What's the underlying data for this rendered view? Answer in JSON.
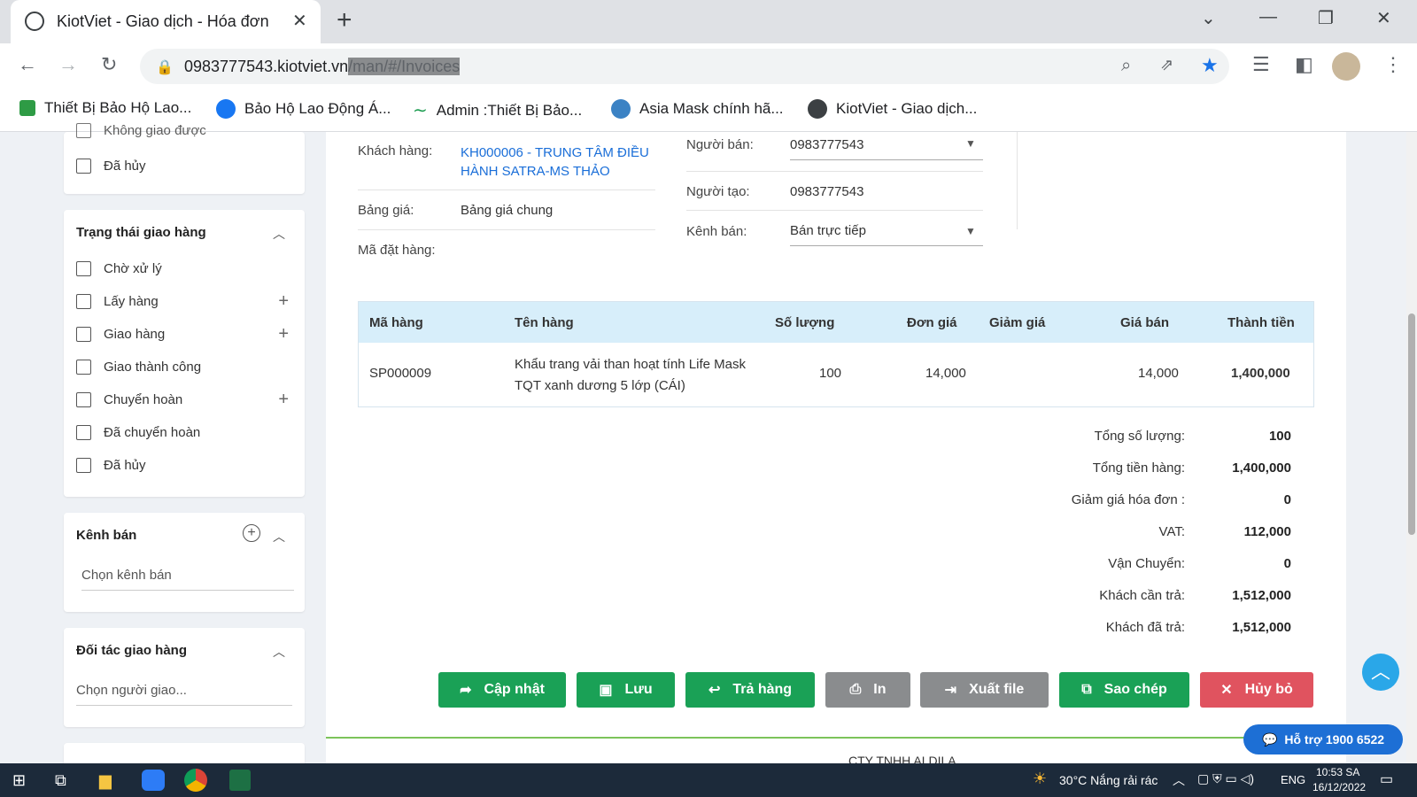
{
  "browser": {
    "tab_title": "KiotViet - Giao dịch - Hóa đơn",
    "url_host": "0983777543.kiotviet.vn",
    "url_path": "/man/#/Invoices",
    "bookmarks": [
      {
        "label": "Thiết Bị Bảo Hộ Lao...",
        "icon": "asia-safe-logo-icon",
        "color": "#2e9b45"
      },
      {
        "label": "Bảo Hộ Lao Động Á...",
        "icon": "facebook-icon",
        "color": "#1877f2"
      },
      {
        "label": "Admin :Thiết Bị Bảo...",
        "icon": "wave-icon",
        "color": "#1a9c4f"
      },
      {
        "label": "Asia Mask chính hã...",
        "icon": "globe-grid-icon",
        "color": "#3b82c4"
      },
      {
        "label": "KiotViet - Giao dịch...",
        "icon": "globe-icon",
        "color": "#3c4043"
      }
    ]
  },
  "sidebar": {
    "top_partial_label": "Không giao được",
    "top_cancelled": "Đã hủy",
    "delivery_status": {
      "title": "Trạng thái giao hàng",
      "items": [
        {
          "label": "Chờ xử lý",
          "expandable": false
        },
        {
          "label": "Lấy hàng",
          "expandable": true
        },
        {
          "label": "Giao hàng",
          "expandable": true
        },
        {
          "label": "Giao thành công",
          "expandable": false
        },
        {
          "label": "Chuyển hoàn",
          "expandable": true
        },
        {
          "label": "Đã chuyển hoàn",
          "expandable": false
        },
        {
          "label": "Đã hủy",
          "expandable": false
        }
      ]
    },
    "channel": {
      "title": "Kênh bán",
      "placeholder": "Chọn kênh bán"
    },
    "partner": {
      "title": "Đối tác giao hàng",
      "placeholder": "Chọn người giao..."
    }
  },
  "invoice": {
    "customer_label": "Khách hàng:",
    "customer_value": "KH000006 - TRUNG TÂM ĐIỀU HÀNH SATRA-MS THẢO",
    "pricebook_label": "Bảng giá:",
    "pricebook_value": "Bảng giá chung",
    "order_code_label": "Mã đặt hàng:",
    "seller_label": "Người bán:",
    "seller_value": "0983777543",
    "creator_label": "Người tạo:",
    "creator_value": "0983777543",
    "channel_label": "Kênh bán:",
    "channel_value": "Bán trực tiếp"
  },
  "table": {
    "headers": [
      "Mã hàng",
      "Tên hàng",
      "Số lượng",
      "Đơn giá",
      "Giảm giá",
      "Giá bán",
      "Thành tiền"
    ],
    "rows": [
      {
        "code": "SP000009",
        "name": "Khẩu trang vải than hoạt tính Life Mask TQT xanh dương 5 lớp (CÁI)",
        "qty": "100",
        "unit_price": "14,000",
        "discount": "",
        "sale_price": "14,000",
        "total": "1,400,000"
      }
    ]
  },
  "summary": [
    {
      "label": "Tổng số lượng:",
      "value": "100"
    },
    {
      "label": "Tổng tiền hàng:",
      "value": "1,400,000"
    },
    {
      "label": "Giảm giá hóa đơn :",
      "value": "0"
    },
    {
      "label": "VAT:",
      "value": "112,000"
    },
    {
      "label": "Vận Chuyển:",
      "value": "0"
    },
    {
      "label": "Khách cần trả:",
      "value": "1,512,000"
    },
    {
      "label": "Khách đã trả:",
      "value": "1,512,000"
    }
  ],
  "actions": {
    "update": "Cập nhật",
    "save": "Lưu",
    "return": "Trả hàng",
    "print": "In",
    "export": "Xuất file",
    "copy": "Sao chép",
    "cancel": "Hủy bỏ"
  },
  "footer_partial": "CTY TNHH ALDILA",
  "support": "Hỗ trợ 1900 6522",
  "taskbar": {
    "weather": "30°C  Nắng rải rác",
    "lang": "ENG",
    "time": "10:53 SA",
    "date": "16/12/2022"
  },
  "colors": {
    "brand_green": "#1aa156",
    "link_blue": "#1a6ed8",
    "cancel_red": "#e0535f",
    "table_header": "#d7eefa"
  }
}
